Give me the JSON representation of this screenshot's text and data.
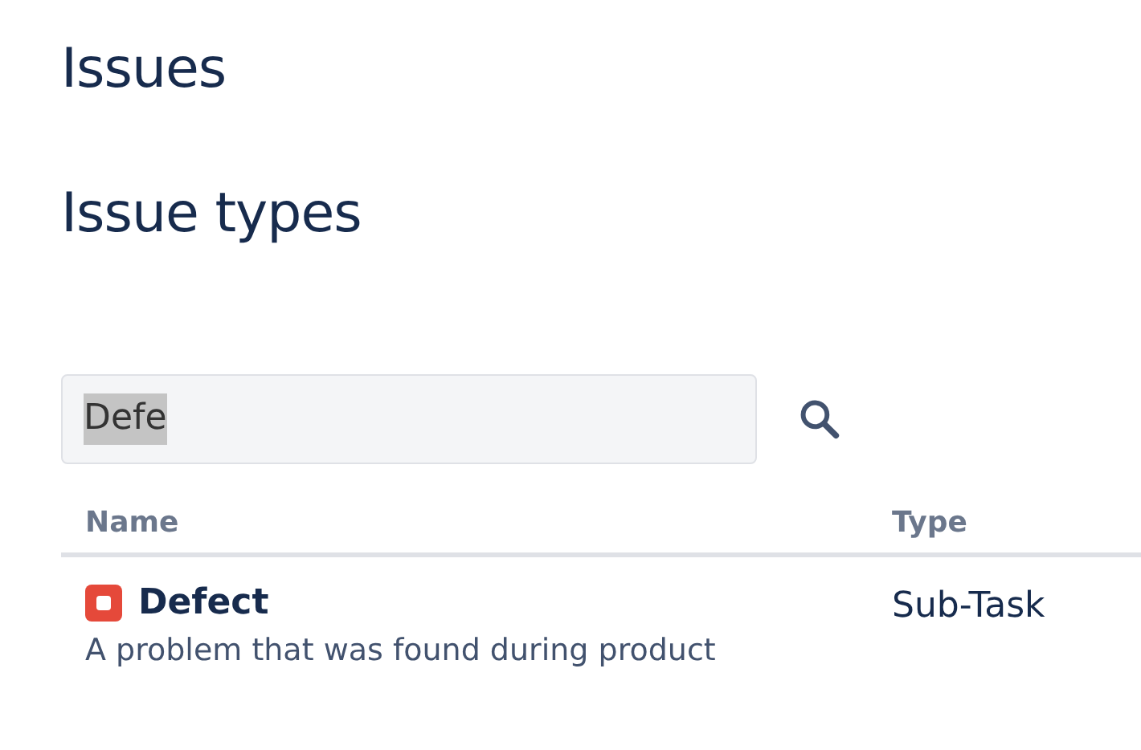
{
  "page_title": "Issues",
  "section_title": "Issue types",
  "search": {
    "value": "Defe",
    "text_selected": true
  },
  "table": {
    "columns": [
      "Name",
      "Type"
    ],
    "rows": [
      {
        "name": "Defect",
        "color": "#e5493a",
        "description": "A problem that was found during product",
        "type": "Sub-Task"
      }
    ]
  }
}
